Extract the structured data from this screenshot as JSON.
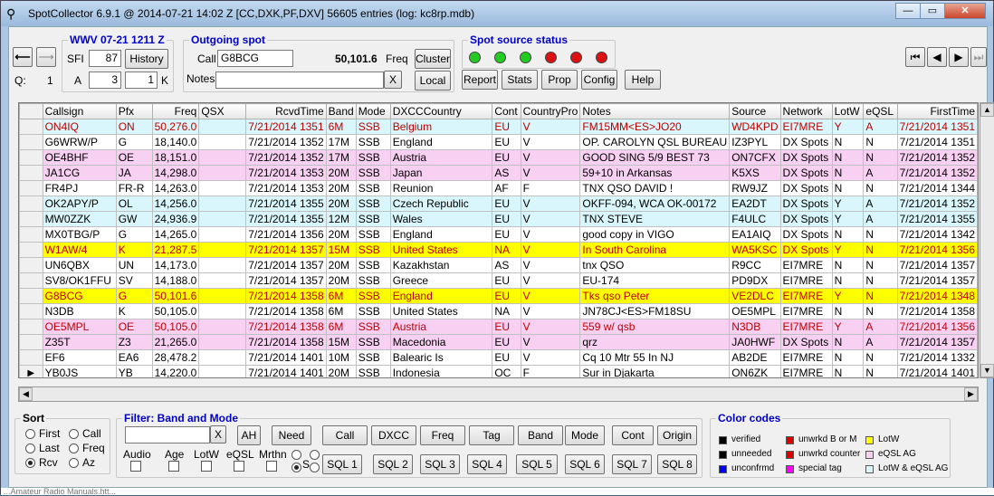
{
  "window": {
    "title": "SpotCollector 6.9.1 @ 2014-07-21  14:02 Z [CC,DXK,PF,DXV] 56605 entries (log: kc8rp.mdb)",
    "minimize": "—",
    "maximize": "▭",
    "close": "✕"
  },
  "nav": {
    "back": "⟵",
    "forward": "⟶",
    "q_label": "Q:",
    "q_value": "1"
  },
  "wwv": {
    "title": "WWV 07-21 1211 Z",
    "sfi_label": "SFI",
    "sfi_value": "87",
    "history": "History",
    "a_label": "A",
    "a_value": "3",
    "k_value": "1",
    "k_label": "K"
  },
  "outgoing": {
    "title": "Outgoing spot",
    "call_label": "Call",
    "call_value": "G8BCG",
    "freq_value": "50,101.6",
    "freq_label": "Freq",
    "notes_label": "Notes",
    "notes_value": "",
    "clear": "X",
    "cluster": "Cluster",
    "local": "Local"
  },
  "status": {
    "title": "Spot source status",
    "leds": [
      "#22cc22",
      "#22cc22",
      "#22cc22",
      "#dd1111",
      "#dd1111",
      "#dd1111"
    ]
  },
  "toolbar": {
    "report": "Report",
    "stats": "Stats",
    "prop": "Prop",
    "config": "Config",
    "help": "Help"
  },
  "transport": [
    "⏮",
    "◀",
    "▶",
    "⏭"
  ],
  "grid": {
    "headers": [
      "Callsign",
      "Pfx",
      "Freq",
      "QSX",
      "RcvdTime",
      "Band",
      "Mode",
      "DXCCCountry",
      "Cont",
      "CountryPro",
      "Notes",
      "Source",
      "Network",
      "LotW",
      "eQSL",
      "FirstTime"
    ],
    "rows": [
      {
        "bg": "#d8f6fb",
        "fg": "#c00000",
        "cells": [
          "ON4IQ",
          "ON",
          "50,276.0",
          "",
          "7/21/2014 1351",
          "6M",
          "SSB",
          "Belgium",
          "EU",
          "V",
          "FM15MM<ES>JO20",
          "WD4KPD",
          "EI7MRE",
          "Y",
          "A",
          "7/21/2014 1351"
        ]
      },
      {
        "bg": "#ffffff",
        "fg": "#000000",
        "cells": [
          "G6WRW/P",
          "G",
          "18,140.0",
          "",
          "7/21/2014 1352",
          "17M",
          "SSB",
          "England",
          "EU",
          "V",
          "OP. CAROLYN  QSL BUREAU",
          "IZ3PYL",
          "DX Spots",
          "N",
          "N",
          "7/21/2014 1351"
        ]
      },
      {
        "bg": "#f8d0f2",
        "fg": "#000000",
        "cells": [
          "OE4BHF",
          "OE",
          "18,151.0",
          "",
          "7/21/2014 1352",
          "17M",
          "SSB",
          "Austria",
          "EU",
          "V",
          "GOOD SING 5/9  BEST 73",
          "ON7CFX",
          "DX Spots",
          "N",
          "N",
          "7/21/2014 1352"
        ]
      },
      {
        "bg": "#f8d0f2",
        "fg": "#000000",
        "cells": [
          "JA1CG",
          "JA",
          "14,298.0",
          "",
          "7/21/2014 1353",
          "20M",
          "SSB",
          "Japan",
          "AS",
          "V",
          "59+10 in Arkansas",
          "K5XS",
          "DX Spots",
          "N",
          "A",
          "7/21/2014 1352"
        ]
      },
      {
        "bg": "#ffffff",
        "fg": "#000000",
        "cells": [
          "FR4PJ",
          "FR-R",
          "14,263.0",
          "",
          "7/21/2014 1353",
          "20M",
          "SSB",
          "Reunion",
          "AF",
          "F",
          "TNX QSO DAVID !",
          "RW9JZ",
          "DX Spots",
          "N",
          "N",
          "7/21/2014 1344"
        ]
      },
      {
        "bg": "#d8f6fb",
        "fg": "#000000",
        "cells": [
          "OK2APY/P",
          "OL",
          "14,256.0",
          "",
          "7/21/2014 1355",
          "20M",
          "SSB",
          "Czech Republic",
          "EU",
          "V",
          "OKFF-094, WCA OK-00172",
          "EA2DT",
          "DX Spots",
          "Y",
          "A",
          "7/21/2014 1352"
        ]
      },
      {
        "bg": "#d8f6fb",
        "fg": "#000000",
        "cells": [
          "MW0ZZK",
          "GW",
          "24,936.9",
          "",
          "7/21/2014 1355",
          "12M",
          "SSB",
          "Wales",
          "EU",
          "V",
          "TNX STEVE",
          "F4ULC",
          "DX Spots",
          "Y",
          "A",
          "7/21/2014 1355"
        ]
      },
      {
        "bg": "#ffffff",
        "fg": "#000000",
        "cells": [
          "MX0TBG/P",
          "G",
          "14,265.0",
          "",
          "7/21/2014 1356",
          "20M",
          "SSB",
          "England",
          "EU",
          "V",
          "good copy in VIGO",
          "EA1AIQ",
          "DX Spots",
          "N",
          "N",
          "7/21/2014 1342"
        ]
      },
      {
        "bg": "#ffff00",
        "fg": "#c00000",
        "cells": [
          "W1AW/4",
          "K",
          "21,287.5",
          "",
          "7/21/2014 1357",
          "15M",
          "SSB",
          "United States",
          "NA",
          "V",
          "In South Carolina",
          "WA5KSC",
          "DX Spots",
          "Y",
          "N",
          "7/21/2014 1356"
        ]
      },
      {
        "bg": "#ffffff",
        "fg": "#000000",
        "cells": [
          "UN6QBX",
          "UN",
          "14,173.0",
          "",
          "7/21/2014 1357",
          "20M",
          "SSB",
          "Kazakhstan",
          "AS",
          "V",
          "tnx QSO",
          "R9CC",
          "EI7MRE",
          "N",
          "N",
          "7/21/2014 1357"
        ]
      },
      {
        "bg": "#ffffff",
        "fg": "#000000",
        "cells": [
          "SV8/OK1FFU",
          "SV",
          "14,188.0",
          "",
          "7/21/2014 1357",
          "20M",
          "SSB",
          "Greece",
          "EU",
          "V",
          "EU-174",
          "PD9DX",
          "EI7MRE",
          "N",
          "N",
          "7/21/2014 1357"
        ]
      },
      {
        "bg": "#ffff00",
        "fg": "#c00000",
        "cells": [
          "G8BCG",
          "G",
          "50,101.6",
          "",
          "7/21/2014 1358",
          "6M",
          "SSB",
          "England",
          "EU",
          "V",
          "Tks qso Peter",
          "VE2DLC",
          "EI7MRE",
          "Y",
          "N",
          "7/21/2014 1348"
        ]
      },
      {
        "bg": "#ffffff",
        "fg": "#000000",
        "cells": [
          "N3DB",
          "K",
          "50,105.0",
          "",
          "7/21/2014 1358",
          "6M",
          "SSB",
          "United States",
          "NA",
          "V",
          "JN78CJ<ES>FM18SU",
          "OE5MPL",
          "EI7MRE",
          "N",
          "N",
          "7/21/2014 1358"
        ]
      },
      {
        "bg": "#f8d0f2",
        "fg": "#c00000",
        "cells": [
          "OE5MPL",
          "OE",
          "50,105.0",
          "",
          "7/21/2014 1358",
          "6M",
          "SSB",
          "Austria",
          "EU",
          "V",
          "559 w/ qsb",
          "N3DB",
          "EI7MRE",
          "Y",
          "A",
          "7/21/2014 1356"
        ]
      },
      {
        "bg": "#f8d0f2",
        "fg": "#000000",
        "cells": [
          "Z35T",
          "Z3",
          "21,265.0",
          "",
          "7/21/2014 1358",
          "15M",
          "SSB",
          "Macedonia",
          "EU",
          "V",
          "qrz",
          "JA0HWF",
          "DX Spots",
          "N",
          "A",
          "7/21/2014 1357"
        ]
      },
      {
        "bg": "#ffffff",
        "fg": "#000000",
        "cells": [
          "EF6",
          "EA6",
          "28,478.2",
          "",
          "7/21/2014 1401",
          "10M",
          "SSB",
          "Balearic Is",
          "EU",
          "V",
          "Cq 10 Mtr 55 In NJ",
          "AB2DE",
          "EI7MRE",
          "N",
          "N",
          "7/21/2014 1332"
        ]
      },
      {
        "bg": "#ffffff",
        "fg": "#000000",
        "cells": [
          "YB0JS",
          "YB",
          "14,220.0",
          "",
          "7/21/2014 1401",
          "20M",
          "SSB",
          "Indonesia",
          "OC",
          "F",
          "Sur in Djakarta",
          "ON6ZK",
          "EI7MRE",
          "N",
          "N",
          "7/21/2014 1401"
        ]
      }
    ]
  },
  "sort": {
    "title": "Sort",
    "first": "First",
    "last": "Last",
    "rcv": "Rcv",
    "call": "Call",
    "freq": "Freq",
    "az": "Az"
  },
  "filter": {
    "title": "Filter: Band and Mode",
    "ah": "AH",
    "need": "Need",
    "clear": "X",
    "audio": "Audio",
    "age": "Age",
    "lotw": "LotW",
    "eqsl": "eQSL",
    "mrthn": "Mrthn",
    "s": "S",
    "row1": [
      "Call",
      "DXCC",
      "Freq",
      "Tag",
      "Band",
      "Mode",
      "Cont",
      "Origin"
    ],
    "row2": [
      "SQL 1",
      "SQL 2",
      "SQL 3",
      "SQL 4",
      "SQL 5",
      "SQL 6",
      "SQL 7",
      "SQL 8"
    ]
  },
  "colorcodes": {
    "title": "Color codes",
    "items": [
      {
        "label": "verified",
        "color": "#000000"
      },
      {
        "label": "unneeded",
        "color": "#000000"
      },
      {
        "label": "unconfrmd",
        "color": "#0000ff"
      },
      {
        "label": "unwrkd B or M",
        "color": "#dd0000"
      },
      {
        "label": "unwrkd counter",
        "color": "#dd0000"
      },
      {
        "label": "special tag",
        "color": "#ff00ff"
      },
      {
        "label": "LotW",
        "color": "#ffff00"
      },
      {
        "label": "eQSL AG",
        "color": "#f8d0f2"
      },
      {
        "label": "LotW & eQSL AG",
        "color": "#d8f6fb"
      }
    ]
  },
  "taskbar": {
    "text": "...Amateur Radio Manuals.htt..."
  }
}
